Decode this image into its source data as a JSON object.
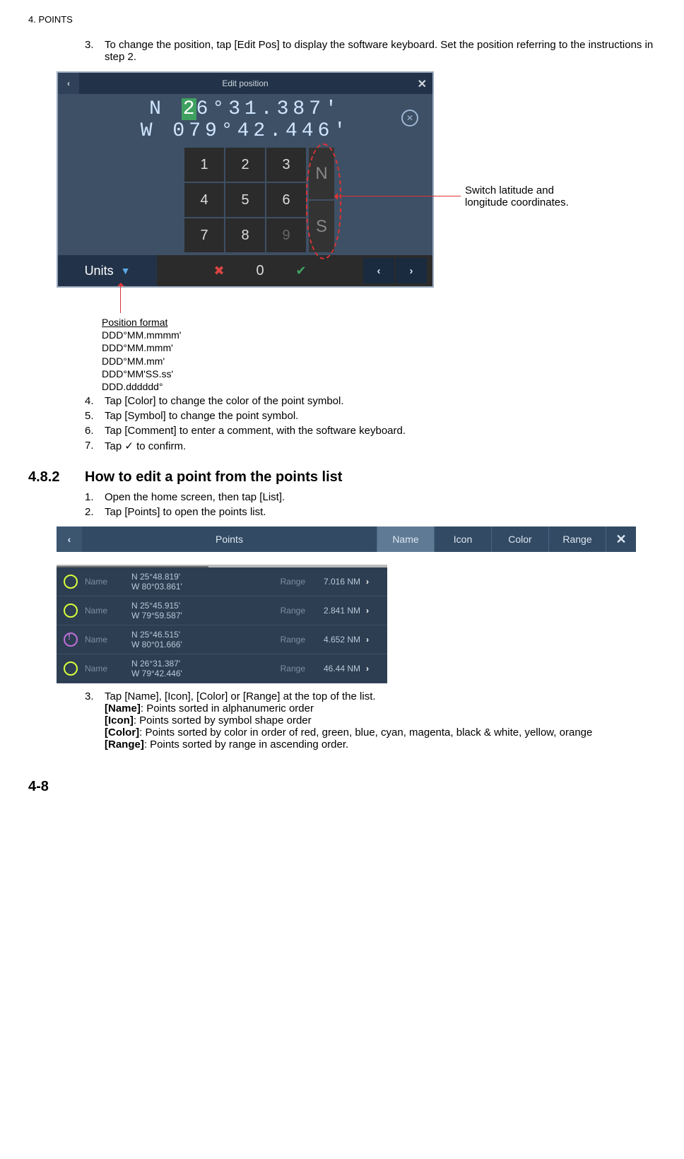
{
  "header": "4.  POINTS",
  "steps_top": [
    {
      "num": "3.",
      "text": "To change the position, tap [Edit Pos] to display the software keyboard. Set the position referring to the instructions in step 2."
    }
  ],
  "edit_pos": {
    "title": "Edit position",
    "lat_prefix": "N ",
    "lat_hl": "2",
    "lat_suffix": "6°31.387'",
    "lon": "W 079°42.446'",
    "keys": [
      "1",
      "2",
      "3",
      "4",
      "5",
      "6",
      "7",
      "8",
      "9"
    ],
    "zero": "0",
    "n_label": "N",
    "s_label": "S",
    "units_label": "Units"
  },
  "annot_switch_l1": "Switch latitude and",
  "annot_switch_l2": "longitude coordinates.",
  "format_title": "Position format",
  "format_1": "DDD°MM.mmmm'",
  "format_2": "DDD°MM.mmm'",
  "format_3": "DDD°MM.mm'",
  "format_4": "DDD°MM'SS.ss'",
  "format_5": "DDD.dddddd°",
  "steps_mid": [
    {
      "num": "4.",
      "text": "Tap [Color] to change the color of the point symbol."
    },
    {
      "num": "5.",
      "text": "Tap [Symbol] to change the point symbol."
    },
    {
      "num": "6.",
      "text": "Tap [Comment] to enter a comment, with the software keyboard."
    },
    {
      "num": "7.",
      "text": "Tap ✓ to confirm."
    }
  ],
  "section": {
    "num": "4.8.2",
    "title": "How to edit a point from the points list"
  },
  "steps_482": [
    {
      "num": "1.",
      "text": "Open the home screen, then tap [List]."
    },
    {
      "num": "2.",
      "text": "Tap [Points] to open the points list."
    }
  ],
  "points_list": {
    "title": "Points",
    "tabs": [
      "Name",
      "Icon",
      "Color",
      "Range"
    ],
    "name_lbl": "Name",
    "range_lbl": "Range",
    "rows": [
      {
        "icon": "ic-yellow",
        "lat": "N 25°48.819'",
        "lon": "W 80°03.861'",
        "range": "7.016 NM"
      },
      {
        "icon": "ic-yellow",
        "lat": "N 25°45.915'",
        "lon": "W 79°59.587'",
        "range": "2.841 NM"
      },
      {
        "icon": "ic-purple",
        "lat": "N 25°46.515'",
        "lon": "W 80°01.666'",
        "range": "4.652 NM"
      },
      {
        "icon": "ic-yellow",
        "lat": "N 26°31.387'",
        "lon": "W 79°42.446'",
        "range": "46.44 NM"
      }
    ]
  },
  "steps_after": {
    "num": "3.",
    "line1": "Tap [Name], [Icon], [Color] or [Range] at the top of the list.",
    "name_b": "[Name]",
    "name_t": ": Points sorted in alphanumeric order",
    "icon_b": "[Icon]",
    "icon_t": ": Points sorted by symbol shape order",
    "color_b": "[Color]",
    "color_t": ": Points sorted by color in order of red, green, blue, cyan, magenta, black & white, yellow, orange",
    "range_b": "[Range]",
    "range_t": ": Points sorted by range in ascending order."
  },
  "page_num": "4-8"
}
